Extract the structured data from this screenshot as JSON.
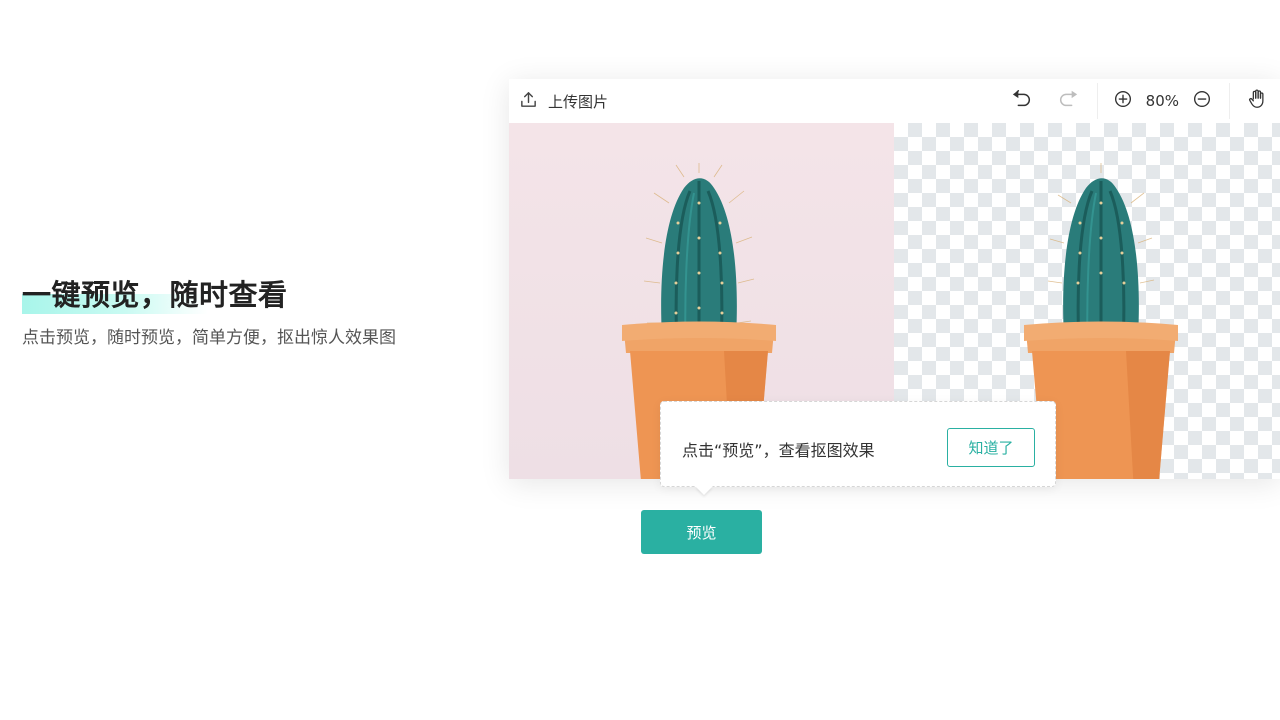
{
  "hero": {
    "title": "一键预览，随时查看",
    "subtitle": "点击预览，随时预览，简单方便，抠出惊人效果图"
  },
  "toolbar": {
    "upload_icon": "upload-icon",
    "upload_label": "上传图片",
    "undo_icon": "undo-icon",
    "redo_icon": "redo-icon",
    "zoom_in_icon": "zoom-in-icon",
    "zoom_level": "80%",
    "zoom_out_icon": "zoom-out-icon",
    "pan_icon": "hand-icon"
  },
  "canvas": {
    "original_image": "cactus-in-orange-pot",
    "result_image": "cactus-cutout-transparent"
  },
  "tooltip": {
    "text": "点击“预览”，查看抠图效果",
    "confirm_label": "知道了"
  },
  "preview_button": {
    "label": "预览"
  },
  "colors": {
    "accent": "#2ab0a2",
    "highlight": "#a8f5ea",
    "pot": "#ee9553",
    "cactus": "#2a7c7a"
  }
}
